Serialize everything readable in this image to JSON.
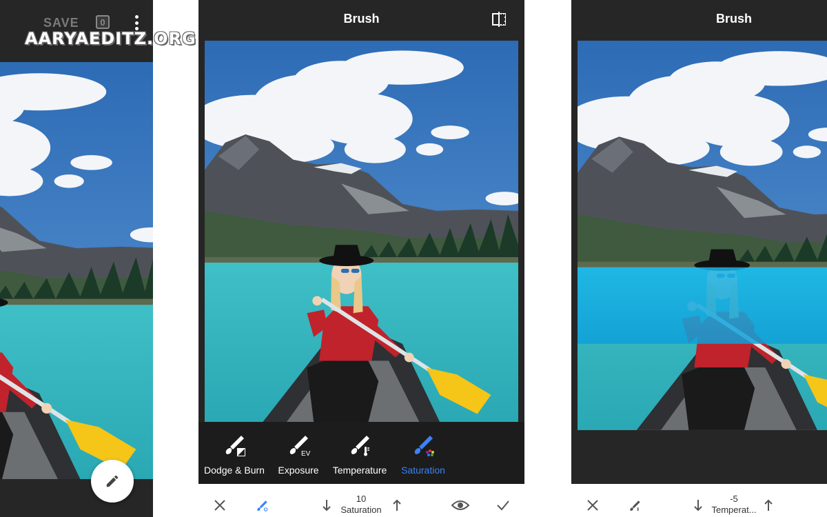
{
  "left_panel": {
    "save_label": "SAVE",
    "edit_count": "0",
    "watermark": "AARYAEDITZ.ORG"
  },
  "middle_panel": {
    "title": "Brush",
    "tools": [
      {
        "label": "Dodge & Burn",
        "icon": "dodge-burn-brush-icon",
        "active": false
      },
      {
        "label": "Exposure",
        "icon": "exposure-brush-icon",
        "badge": "EV",
        "active": false
      },
      {
        "label": "Temperature",
        "icon": "temperature-brush-icon",
        "active": false
      },
      {
        "label": "Saturation",
        "icon": "saturation-brush-icon",
        "active": true
      }
    ],
    "bottom": {
      "value": "10",
      "param_label": "Saturation"
    }
  },
  "right_panel": {
    "title": "Brush",
    "bottom": {
      "value": "-5",
      "param_label": "Temperat..."
    }
  },
  "colors": {
    "app_dark": "#262626",
    "toolstrip": "#1c1c1c",
    "accent_blue": "#3b82f6",
    "paddle_yellow": "#f5c518",
    "lake_teal": "#34b3bf",
    "lake_saturated": "#18a9e0"
  }
}
